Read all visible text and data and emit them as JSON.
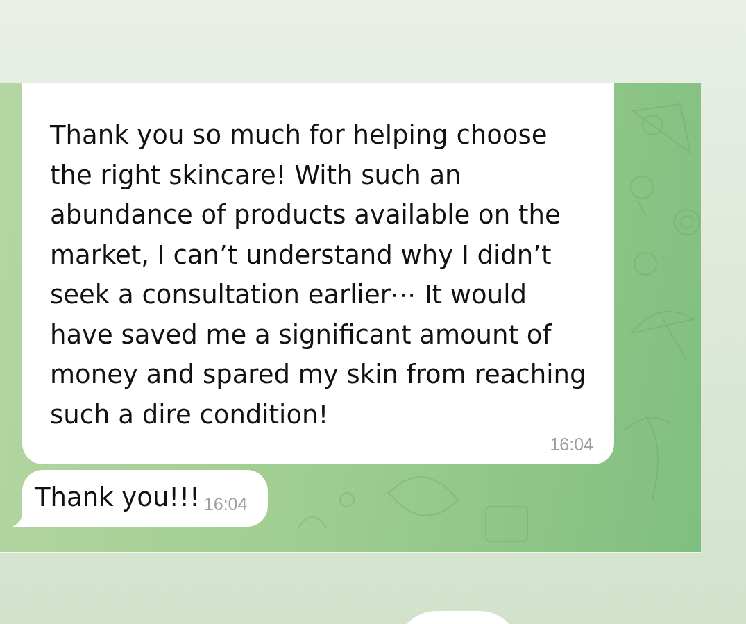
{
  "messages": [
    {
      "text": "Thank you so much for helping choose the right skincare! With such an abundance of products available on the market, I can’t understand why I didn’t seek a consultation earlier⋯ It would have saved me a significant amount of money and spared my skin from reaching such a dire condition!",
      "time": "16:04",
      "tail": false
    },
    {
      "text": "Thank you!!!",
      "time": "16:04",
      "tail": true
    }
  ]
}
